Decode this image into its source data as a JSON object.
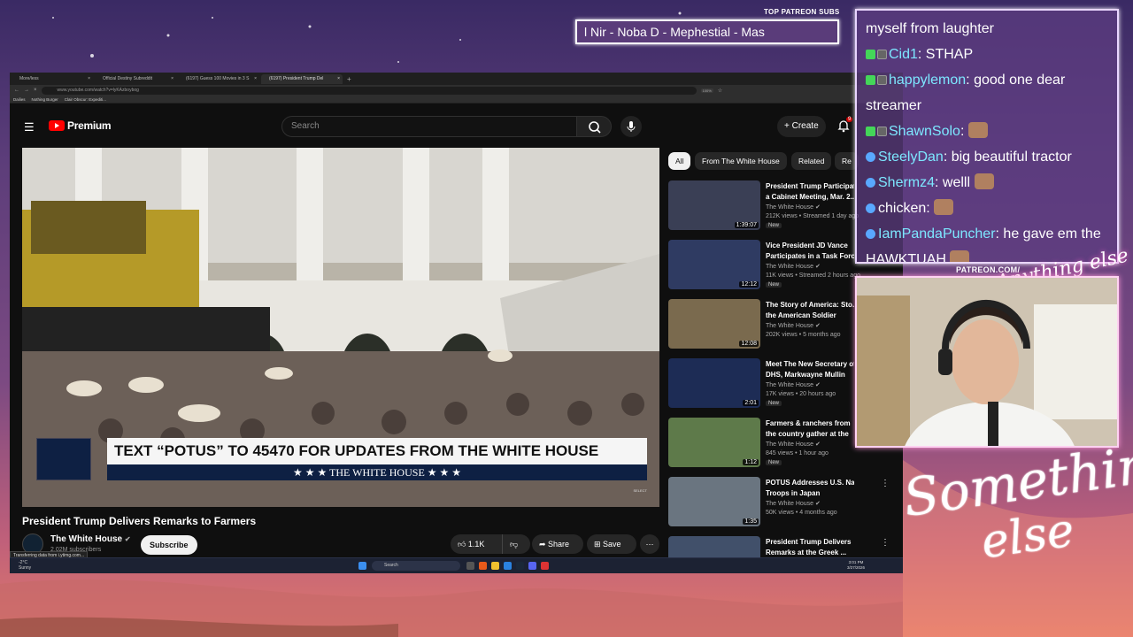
{
  "overlay": {
    "patreon_label": "TOP PATREON SUBS",
    "patreon_ticker": "l Nir - Noba D - Mephestial - Mas",
    "patreon_url": "PATREON.COM/",
    "signature": "Anything else",
    "brand_line1": "Something",
    "brand_line2": "else"
  },
  "chat": [
    {
      "badges": [],
      "user": "",
      "message": "myself from laughter"
    },
    {
      "badges": [
        "k-badge",
        "sub-badge"
      ],
      "user": "Cid1",
      "message": ": STHAP"
    },
    {
      "badges": [
        "k-badge",
        "sub-badge"
      ],
      "user": "happylemon",
      "message": ": good one dear streamer"
    },
    {
      "badges": [
        "k-badge",
        "sub-badge"
      ],
      "user": "ShawnSolo",
      "message": ":"
    },
    {
      "badges": [
        "mod-badge"
      ],
      "user": "SteelyDan",
      "message": ": big beautiful tractor"
    },
    {
      "badges": [
        "mod-badge"
      ],
      "user": "Shermz4",
      "message": ": welll"
    },
    {
      "badges": [
        "mod-badge"
      ],
      "user": "chicken",
      "message": ":"
    },
    {
      "badges": [
        "mod-badge"
      ],
      "user": "IamPandaPuncher",
      "message": ": he gave em the HAWKTUAH"
    }
  ],
  "browser": {
    "tabs": [
      {
        "label": "More/less"
      },
      {
        "label": "Official Destiny Subreddit"
      },
      {
        "label": "(6197) Guess 100 Movies in 3 S"
      },
      {
        "label": "(6197) President Trump Del"
      }
    ],
    "new_tab": "+",
    "url": "www.youtube.com/watch?v=lyKAzboybog",
    "zoom": "100%",
    "bookmarks": [
      "Dailies",
      "Nothing Burger",
      "Clair Obscur: Expediti..."
    ]
  },
  "youtube": {
    "logo_text": "Premium",
    "search_placeholder": "Search",
    "create_label": "Create",
    "notif_badge": "9",
    "video": {
      "lower_third_main": "TEXT “POTUS” TO 45470 FOR UPDATES FROM THE WHITE HOUSE",
      "lower_third_sub": "★ ★ ★   THE WHITE HOUSE   ★ ★ ★",
      "watermark": "SELECT"
    },
    "title": "President Trump Delivers Remarks to Farmers",
    "channel": "The White House",
    "subscribers": "2.02M subscribers",
    "subscribe_label": "Subscribe",
    "status_link": "Transferring data from i.ytimg.com...",
    "likes": "1.1K",
    "share_label": "Share",
    "save_label": "Save",
    "chips": [
      "All",
      "From The White House",
      "Related",
      "Re"
    ],
    "related": [
      {
        "title1": "President Trump Participates in",
        "title2": "a Cabinet Meeting, Mar. 2...",
        "channel": "The White House",
        "meta": "212K views • Streamed 1 day ago",
        "new": "New",
        "duration": "1:39:07",
        "thumb": "#3a3f55"
      },
      {
        "title1": "Vice President JD Vance",
        "title2": "Participates in a Task Force",
        "channel": "The White House",
        "meta": "11K views • Streamed 2 hours ago",
        "new": "New",
        "duration": "12:12",
        "thumb": "#2f3b62"
      },
      {
        "title1": "The Story of America: Sto...",
        "title2": "the American Soldier",
        "channel": "The White House",
        "meta": "202K views • 5 months ago",
        "new": "",
        "duration": "12:08",
        "thumb": "#7a6a4e"
      },
      {
        "title1": "Meet The New Secretary of",
        "title2": "DHS, Markwayne Mullin",
        "channel": "The White House",
        "meta": "17K views • 20 hours ago",
        "new": "New",
        "duration": "2:01",
        "thumb": "#1d2c55"
      },
      {
        "title1": "Farmers & ranchers from",
        "title2": "the country gather at the",
        "channel": "The White House",
        "meta": "845 views • 1 hour ago",
        "new": "New",
        "duration": "1:12",
        "thumb": "#5e7a4a"
      },
      {
        "title1": "POTUS Addresses U.S. Navy",
        "title2": "Troops in Japan",
        "channel": "The White House",
        "meta": "50K views • 4 months ago",
        "new": "",
        "duration": "1:35",
        "thumb": "#6a7580"
      },
      {
        "title1": "President Trump Delivers",
        "title2": "Remarks at the Greek ...",
        "channel": "",
        "meta": "",
        "new": "",
        "duration": "",
        "thumb": "#41506a"
      }
    ]
  },
  "taskbar": {
    "weather_temp": "-2°C",
    "weather_desc": "Sunny",
    "search": "Search",
    "time": "3:01 PM",
    "date": "3/27/2026"
  }
}
